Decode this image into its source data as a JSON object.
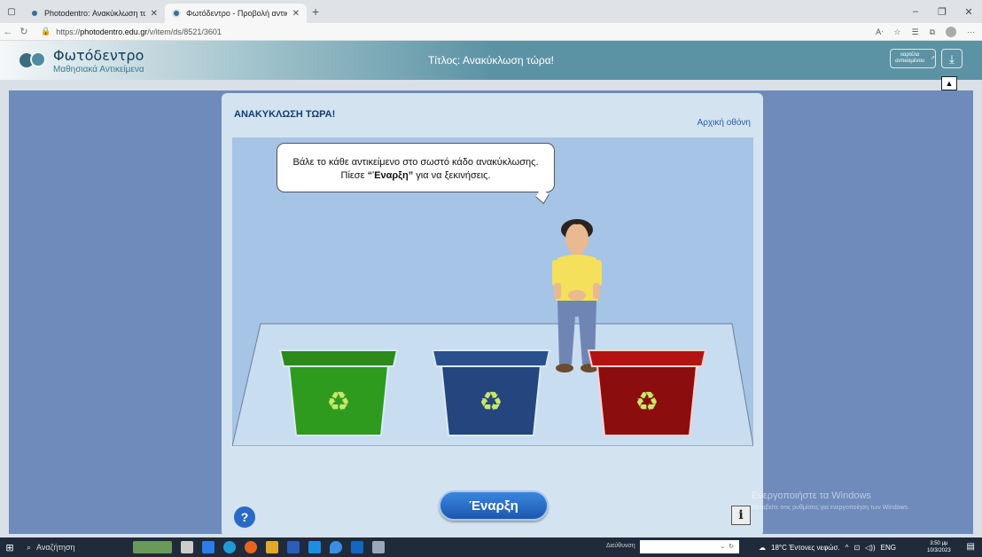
{
  "browser": {
    "tabs": [
      {
        "title": "Photodentro: Ανακύκλωση τώρ",
        "active": false
      },
      {
        "title": "Φωτόδεντρο - Προβολή αντικε",
        "active": true
      }
    ],
    "url_prefix": "https://",
    "url_host": "photodentro.edu.gr",
    "url_path": "/v/item/ds/8521/3601"
  },
  "site": {
    "logo_title": "Φωτόδεντρο",
    "logo_subtitle": "Μαθησιακά Αντικείμενα",
    "page_title": "Τίτλος: Ανακύκλωση τώρα!",
    "tab_button": "καρτέλα αντικειμένου"
  },
  "activity": {
    "title": "ΑΝΑΚΥΚΛΩΣΗ ΤΩΡΑ!",
    "home_link": "Αρχική οθόνη",
    "bubble_line1": "Βάλε το κάθε αντικείμενο στο σωστό κάδο ανακύκλωσης.",
    "bubble_pre": "Πίεσε ",
    "bubble_bold": "“Έναρξη”",
    "bubble_post": " για να ξεκινήσεις.",
    "start_button": "Έναρξη",
    "help_button": "?",
    "info_button": "i",
    "bins": [
      {
        "color": "green",
        "fill": "#2e9b1f",
        "rim": "#2c8a1b"
      },
      {
        "color": "blue",
        "fill": "#24457d",
        "rim": "#2a4f8d"
      },
      {
        "color": "red",
        "fill": "#8b0d0d",
        "rim": "#b21212"
      }
    ]
  },
  "watermark": {
    "line1": "Ενεργοποιήστε τα Windows",
    "line2": "Μεταβείτε στις ρυθμίσεις για ενεργοποίηση των Windows."
  },
  "taskbar": {
    "search": "Αναζήτηση",
    "address_label": "Διεύθυνση",
    "weather": "18°C Έντονες νεφώσ.",
    "lang": "ENG",
    "time": "3:50 μμ",
    "date": "10/3/2023"
  }
}
